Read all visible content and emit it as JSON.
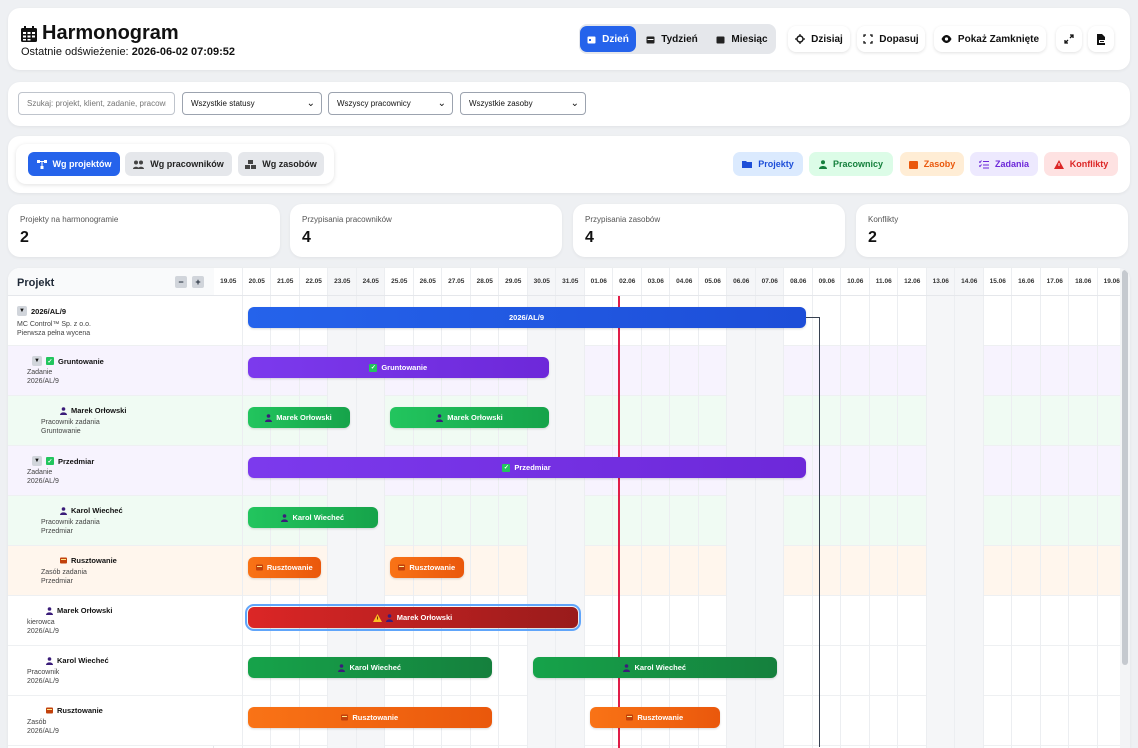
{
  "header": {
    "title": "Harmonogram",
    "refresh_label": "Ostatnie odświeżenie:",
    "refresh_value": "2026-06-02 07:09:52",
    "views": [
      "Dzień",
      "Tydzień",
      "Miesiąc"
    ],
    "active_view": "Dzień",
    "today_label": "Dzisiaj",
    "fit_label": "Dopasuj",
    "show_closed_label": "Pokaż Zamknięte"
  },
  "filters": {
    "search_placeholder": "Szukaj: projekt, klient, zadanie, pracownik",
    "status": "Wszystkie statusy",
    "workers": "Wszyscy pracownicy",
    "resources": "Wszystkie zasoby"
  },
  "grouping": {
    "options": [
      "Wg projektów",
      "Wg pracowników",
      "Wg zasobów"
    ],
    "active": "Wg projektów"
  },
  "legend": [
    {
      "label": "Projekty",
      "color": "#1d4ed8",
      "bg": "#dbeafe"
    },
    {
      "label": "Pracownicy",
      "color": "#15803d",
      "bg": "#dcfce7"
    },
    {
      "label": "Zasoby",
      "color": "#ea580c",
      "bg": "#ffedd5"
    },
    {
      "label": "Zadania",
      "color": "#6d28d9",
      "bg": "#ede9fe"
    },
    {
      "label": "Konflikty",
      "color": "#dc2626",
      "bg": "#fee2e2"
    }
  ],
  "stats": [
    {
      "label": "Projekty na harmonogramie",
      "value": "2"
    },
    {
      "label": "Przypisania pracowników",
      "value": "4"
    },
    {
      "label": "Przypisania zasobów",
      "value": "4"
    },
    {
      "label": "Konflikty",
      "value": "2"
    }
  ],
  "gantt": {
    "column_header": "Projekt",
    "today": "02.06",
    "dates": [
      "19.05",
      "20.05",
      "21.05",
      "22.05",
      "23.05",
      "24.05",
      "25.05",
      "26.05",
      "27.05",
      "28.05",
      "29.05",
      "30.05",
      "31.05",
      "01.06",
      "02.06",
      "03.06",
      "04.06",
      "05.06",
      "06.06",
      "07.06",
      "08.06",
      "09.06",
      "10.06",
      "11.06",
      "12.06",
      "13.06",
      "14.06",
      "15.06",
      "16.06",
      "17.06",
      "18.06",
      "19.06"
    ],
    "weekend_dates": [
      "23.05",
      "24.05",
      "30.05",
      "31.05",
      "06.06",
      "07.06",
      "13.06",
      "14.06"
    ],
    "rows": [
      {
        "title": "2026/AL/9",
        "sub": [
          "MC Control™ Sp. z o.o.",
          "Pierwsza pełna wycena"
        ],
        "kind": "project",
        "level": 0,
        "toggle": true,
        "bg": "#ffffff"
      },
      {
        "title": "Gruntowanie",
        "sub": [
          "Zadanie",
          "2026/AL/9"
        ],
        "kind": "task",
        "level": 1,
        "toggle": true,
        "bg": "#f7f3fe"
      },
      {
        "title": "Marek Orłowski",
        "sub": [
          "Pracownik zadania",
          "Gruntowanie"
        ],
        "kind": "worker",
        "level": 2,
        "toggle": false,
        "bg": "#f0fbf3"
      },
      {
        "title": "Przedmiar",
        "sub": [
          "Zadanie",
          "2026/AL/9"
        ],
        "kind": "task",
        "level": 1,
        "toggle": true,
        "bg": "#f7f3fe"
      },
      {
        "title": "Karol Wiecheć",
        "sub": [
          "Pracownik zadania",
          "Przedmiar"
        ],
        "kind": "worker",
        "level": 2,
        "toggle": false,
        "bg": "#f0fbf3"
      },
      {
        "title": "Rusztowanie",
        "sub": [
          "Zasób zadania",
          "Przedmiar"
        ],
        "kind": "resource",
        "level": 2,
        "toggle": false,
        "bg": "#fff6ed"
      },
      {
        "title": "Marek Orłowski",
        "sub": [
          "kierowca",
          "2026/AL/9"
        ],
        "kind": "worker",
        "level": 1,
        "toggle": false,
        "bg": "#ffffff"
      },
      {
        "title": "Karol Wiecheć",
        "sub": [
          "Pracownik",
          "2026/AL/9"
        ],
        "kind": "worker",
        "level": 1,
        "toggle": false,
        "bg": "#ffffff"
      },
      {
        "title": "Rusztowanie",
        "sub": [
          "Zasób",
          "2026/AL/9"
        ],
        "kind": "resource",
        "level": 1,
        "toggle": false,
        "bg": "#ffffff"
      }
    ],
    "bars": [
      {
        "row": 0,
        "start": "20.05",
        "end": "08.06",
        "label": "2026/AL/9",
        "type": "project"
      },
      {
        "row": 1,
        "start": "20.05",
        "end": "30.05",
        "label": "Gruntowanie",
        "type": "task"
      },
      {
        "row": 2,
        "start": "20.05",
        "end": "23.05",
        "label": "Marek Orłowski",
        "type": "task-worker"
      },
      {
        "row": 2,
        "start": "25.05",
        "end": "30.05",
        "label": "Marek Orłowski",
        "type": "task-worker"
      },
      {
        "row": 3,
        "start": "20.05",
        "end": "08.06",
        "label": "Przedmiar",
        "type": "task"
      },
      {
        "row": 4,
        "start": "20.05",
        "end": "24.05",
        "label": "Karol Wiecheć",
        "type": "task-worker"
      },
      {
        "row": 5,
        "start": "20.05",
        "end": "22.05",
        "label": "Rusztowanie",
        "type": "resource"
      },
      {
        "row": 5,
        "start": "25.05",
        "end": "27.05",
        "label": "Rusztowanie",
        "type": "resource"
      },
      {
        "row": 6,
        "start": "20.05",
        "end": "31.05",
        "label": "Marek Orłowski",
        "type": "conflict"
      },
      {
        "row": 7,
        "start": "20.05",
        "end": "28.05",
        "label": "Karol Wiecheć",
        "type": "worker"
      },
      {
        "row": 7,
        "start": "30.05",
        "end": "07.06",
        "label": "Karol Wiecheć",
        "type": "worker"
      },
      {
        "row": 8,
        "start": "20.05",
        "end": "28.05",
        "label": "Rusztowanie",
        "type": "resource"
      },
      {
        "row": 8,
        "start": "01.06",
        "end": "05.06",
        "label": "Rusztowanie",
        "type": "resource"
      }
    ]
  }
}
